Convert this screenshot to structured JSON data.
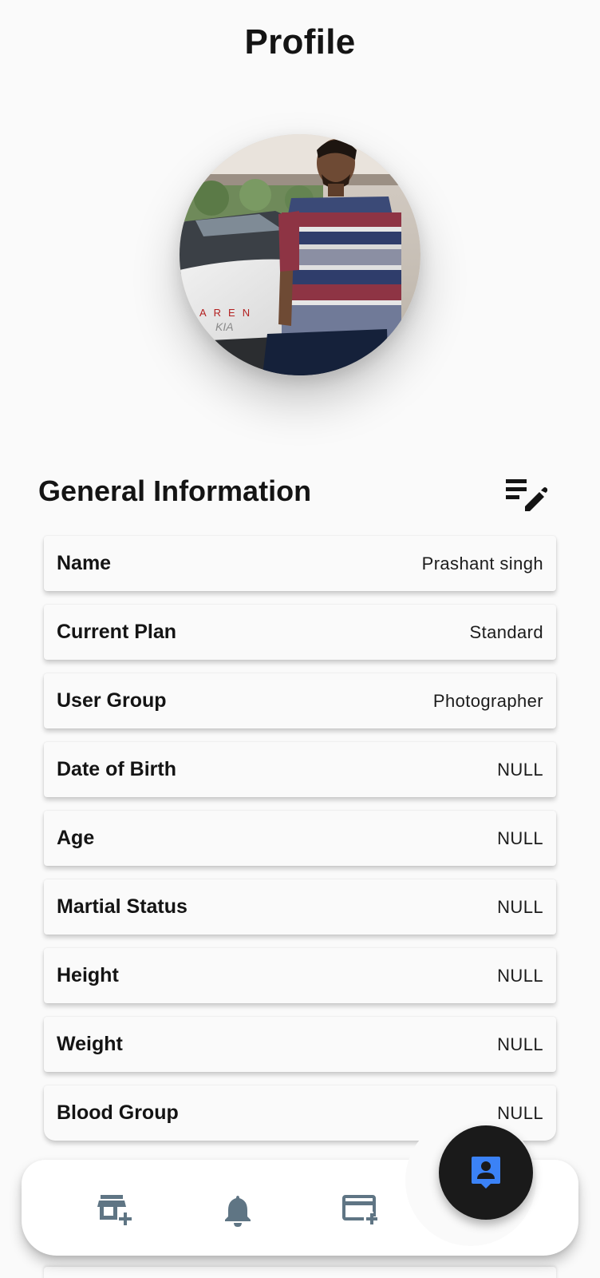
{
  "header": {
    "title": "Profile"
  },
  "profile": {
    "avatar_icon": "profile-photo",
    "section_title": "General Information",
    "edit_icon": "edit-list-icon"
  },
  "fields": [
    {
      "label": "Name",
      "value": "Prashant singh"
    },
    {
      "label": "Current Plan",
      "value": "Standard"
    },
    {
      "label": "User Group",
      "value": "Photographer"
    },
    {
      "label": "Date of Birth",
      "value": "NULL"
    },
    {
      "label": "Age",
      "value": "NULL"
    },
    {
      "label": "Martial Status",
      "value": "NULL"
    },
    {
      "label": "Height",
      "value": "NULL"
    },
    {
      "label": "Weight",
      "value": "NULL"
    },
    {
      "label": "Blood Group",
      "value": "NULL"
    }
  ],
  "bottom_nav": {
    "items": [
      {
        "icon": "add-store-icon"
      },
      {
        "icon": "bell-icon"
      },
      {
        "icon": "add-card-icon"
      },
      {
        "icon": "profile-badge-icon",
        "active": true
      }
    ],
    "colors": {
      "inactive": "#5f7584",
      "active": "#3b82f6",
      "fab": "#1a1a1a"
    }
  }
}
